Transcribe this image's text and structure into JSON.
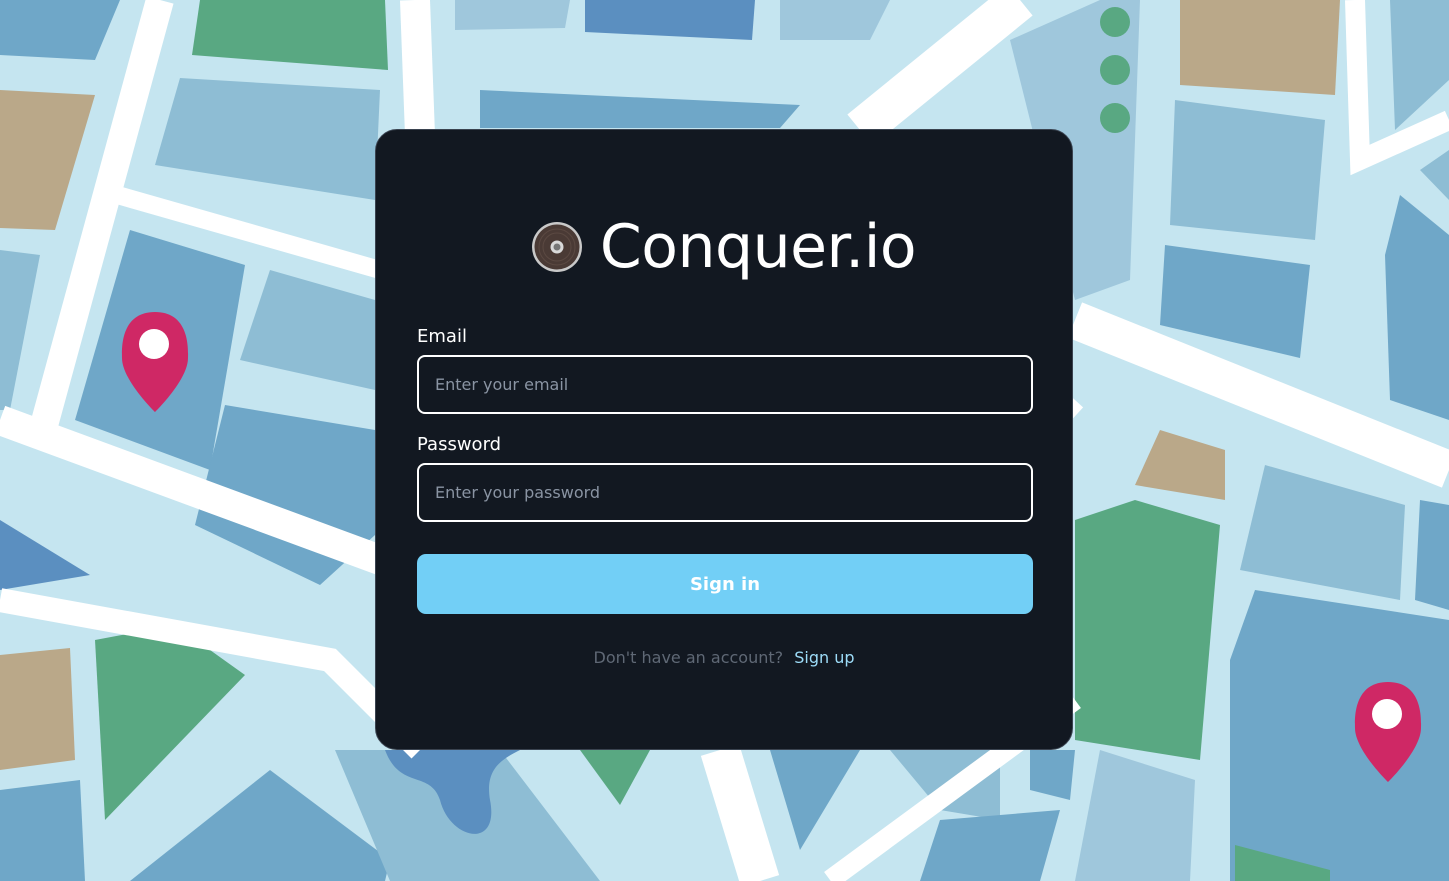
{
  "brand": {
    "name": "Conquer.io",
    "logo_icon": "disc-logo-icon"
  },
  "form": {
    "email_label": "Email",
    "email_placeholder": "Enter your email",
    "email_value": "",
    "password_label": "Password",
    "password_placeholder": "Enter your password",
    "password_value": "",
    "signin_label": "Sign in"
  },
  "footer": {
    "prompt": "Don't have an account?",
    "signup_label": "Sign up"
  },
  "colors": {
    "card_bg": "#121821",
    "button": "#72cff6",
    "link": "#9ddcf8",
    "map_road": "#c5e5f0",
    "map_block": "#6fa7c8",
    "map_park": "#59a882",
    "map_sand": "#baa889",
    "pin": "#cf2865"
  }
}
